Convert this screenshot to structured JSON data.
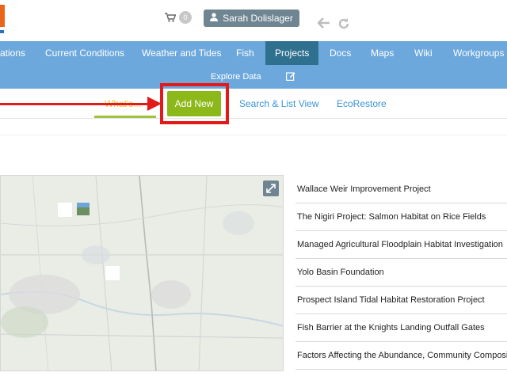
{
  "header": {
    "cart_count": "0",
    "user_name": "Sarah Dolislager"
  },
  "nav": {
    "items": [
      {
        "label": "ations"
      },
      {
        "label": "Current Conditions"
      },
      {
        "label": "Weather and Tides"
      },
      {
        "label": "Fish"
      },
      {
        "label": "Projects"
      },
      {
        "label": "Docs"
      },
      {
        "label": "Maps"
      },
      {
        "label": "Wiki"
      },
      {
        "label": "Workgroups"
      }
    ],
    "active": "Projects",
    "explore_label": "Explore Data"
  },
  "subtabs": {
    "first_label": "What's...",
    "add_new_label": "Add New",
    "search_list_label": "Search & List View",
    "ecorestore_label": "EcoRestore"
  },
  "projects": [
    "Wallace Weir Improvement Project",
    "The Nigiri Project: Salmon Habitat on Rice Fields",
    "Managed Agricultural Floodplain Habitat Investigation",
    "Yolo Basin Foundation",
    "Prospect Island Tidal Habitat Restoration Project",
    "Fish Barrier at the Knights Landing Outfall Gates",
    "Factors Affecting the Abundance, Community Composi"
  ],
  "colors": {
    "nav_bg": "#6da8dc",
    "nav_active": "#30708f",
    "add_new": "#8cb81a",
    "highlight": "#e21a1a",
    "link": "#3b95d8"
  },
  "icons": [
    "cart-icon",
    "user-icon",
    "back-arrow-icon",
    "refresh-icon",
    "edit-icon",
    "expand-icon"
  ]
}
